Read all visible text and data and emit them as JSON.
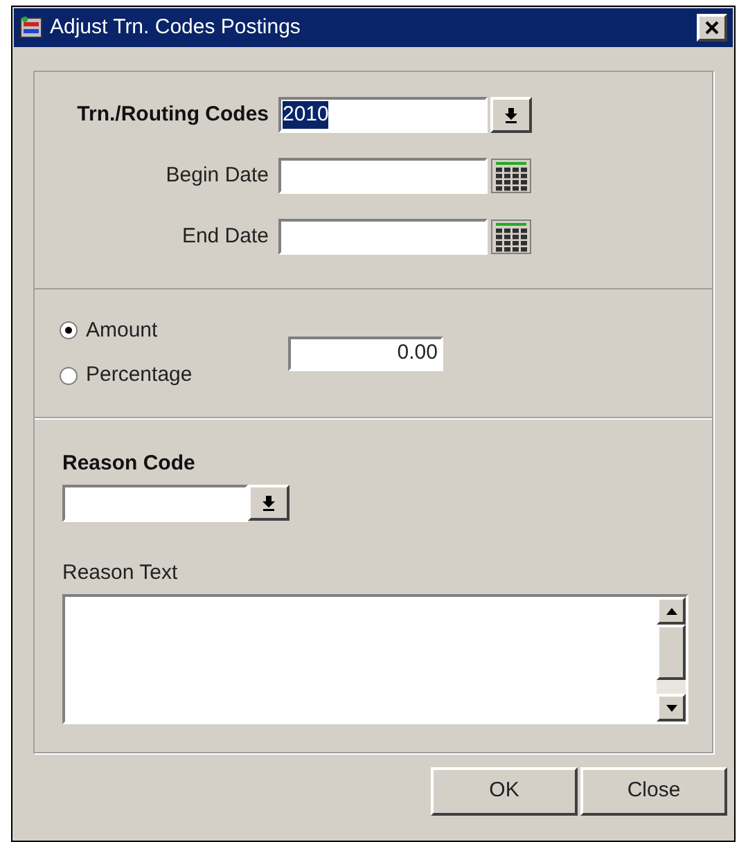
{
  "window": {
    "title": "Adjust Trn. Codes Postings"
  },
  "codes_section": {
    "trn_routing_codes": {
      "label": "Trn./Routing Codes",
      "value": "2010",
      "value_selected": true
    },
    "begin_date": {
      "label": "Begin Date"
    },
    "end_date": {
      "label": "End Date"
    }
  },
  "adjust_by": {
    "options": [
      {
        "label": "Amount",
        "selected": true
      },
      {
        "label": "Percentage",
        "selected": false
      }
    ],
    "value": "0.00"
  },
  "reason_code": {
    "label": "Reason Code"
  },
  "reason_text": {
    "label": "Reason Text"
  },
  "buttons": [
    {
      "label": "OK"
    },
    {
      "label": "Close"
    }
  ]
}
